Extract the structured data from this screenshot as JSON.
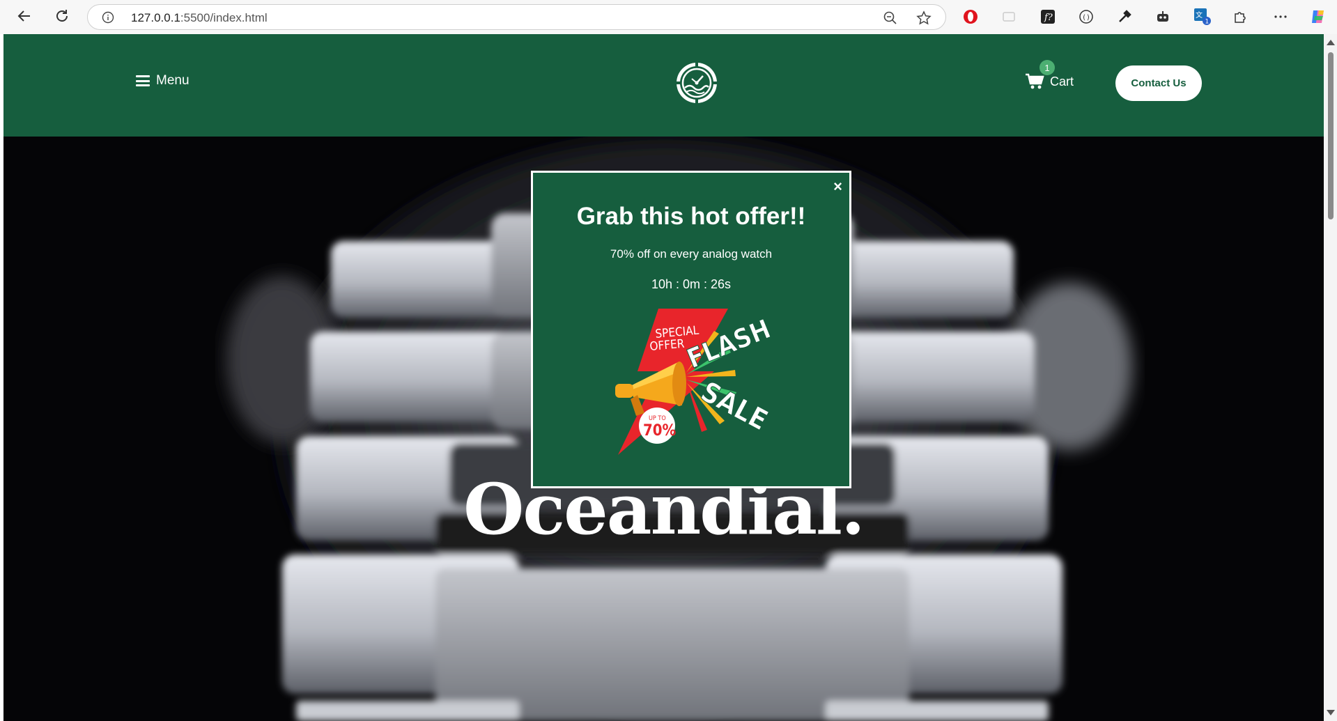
{
  "browser": {
    "url_host": "127.0.0.1",
    "url_path": ":5500/index.html"
  },
  "header": {
    "menu_label": "Menu",
    "cart_label": "Cart",
    "cart_count": "1",
    "contact_label": "Contact Us",
    "brand_color": "#165e3e"
  },
  "hero": {
    "title": "Oceandial."
  },
  "popup": {
    "close_label": "×",
    "title": "Grab this hot offer!!",
    "subtitle": "70% off on every analog watch",
    "timer": "10h : 0m : 26s",
    "image": {
      "special_line1": "SPECIAL",
      "special_line2": "OFFER",
      "flash": "FLASH",
      "sale": "SALE",
      "upto": "UP TO",
      "percent": "70%"
    }
  }
}
